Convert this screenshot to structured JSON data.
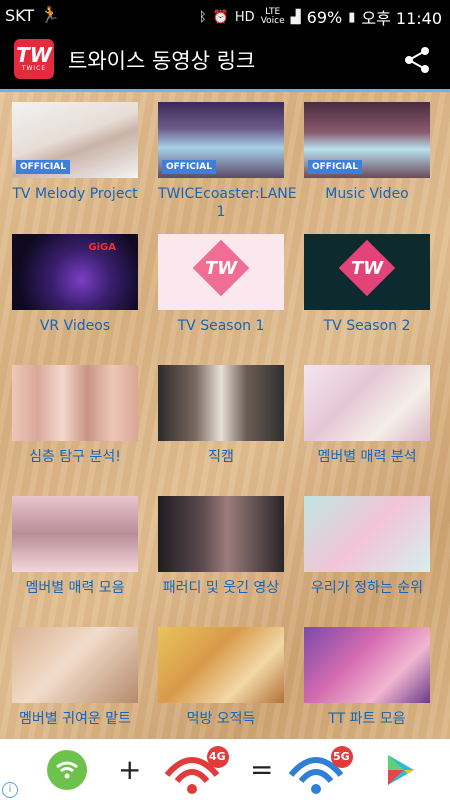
{
  "status_bar": {
    "carrier": "SKT",
    "lte_top": "LTE",
    "voice": "Voice",
    "battery": "69%",
    "time": "오후 11:40"
  },
  "app_bar": {
    "logo_text": "TW",
    "logo_sub": "TWICE",
    "title": "트와이스 동영상 링크"
  },
  "thumb_labels": {
    "official": "OFFICIAL",
    "giga": "GiGA",
    "tv_logo": "TW"
  },
  "grid": [
    {
      "label": "TV Melody Project"
    },
    {
      "label": "TWICEcoaster:LANE 1"
    },
    {
      "label": "Music Video"
    },
    {
      "label": "VR Videos"
    },
    {
      "label": "TV Season 1"
    },
    {
      "label": "TV Season 2"
    },
    {
      "label": "심층 탐구 분석!"
    },
    {
      "label": "직캠"
    },
    {
      "label": "멤버별 매력 분석"
    },
    {
      "label": "멤버별 매력 모음"
    },
    {
      "label": "패러디 및 웃긴 영상"
    },
    {
      "label": "우리가 정하는 순위"
    },
    {
      "label": "멤버별 귀여운 맡트"
    },
    {
      "label": "먹방 오적득"
    },
    {
      "label": "TT 파트 모음"
    }
  ],
  "ad": {
    "plus": "+",
    "equals": "=",
    "badge_4g": "4G",
    "badge_5g": "5G",
    "info": "i"
  },
  "colors": {
    "accent": "#5dbbe6",
    "label": "#1565b8",
    "brand_red": "#e32b3b"
  }
}
